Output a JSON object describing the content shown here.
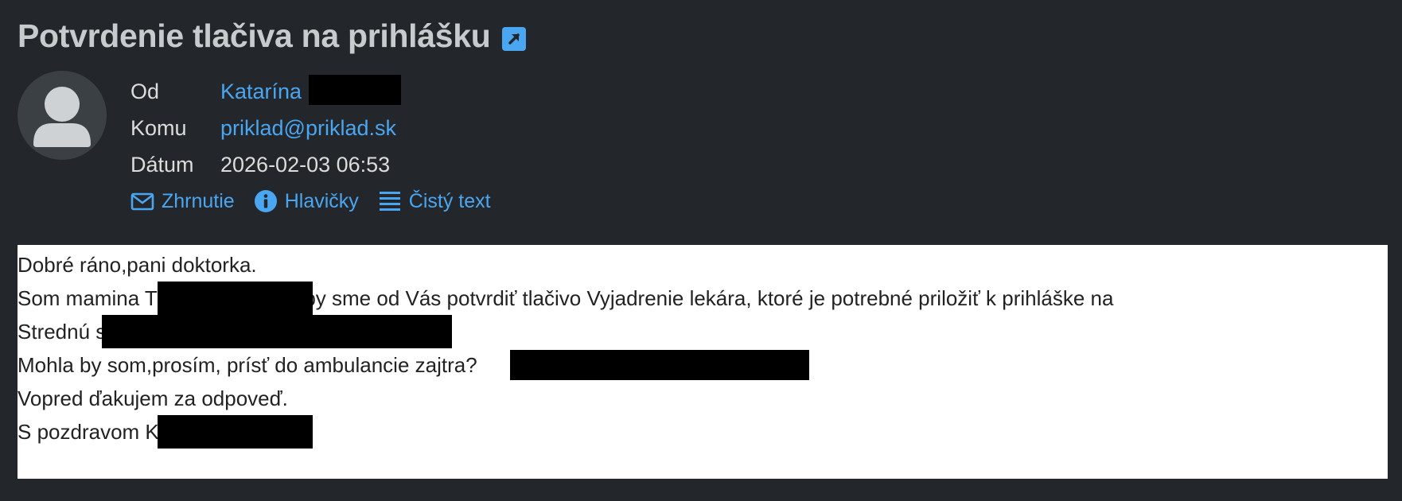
{
  "email": {
    "subject": "Potvrdenie tlačiva na prihlášku",
    "from_label": "Od",
    "from_name": "Katarína",
    "to_label": "Komu",
    "to_value": "priklad@priklad.sk",
    "date_label": "Dátum",
    "date_value": "2026-02-03 06:53"
  },
  "actions": {
    "summary": "Zhrnutie",
    "headers": "Hlavičky",
    "plain_text": "Čistý text"
  },
  "body": {
    "line1": "Dobré ráno,pani doktorka.",
    "line2": "Som mamina T                       n a  potrebovali by sme od Vás  potvrdiť tlačivo Vyjadrenie lekára, ktoré je potrebné priložiť k prihláške na",
    "line3": "Strednú s                                                                              .",
    "line4": "Mohla by som,prosím, prísť do ambulancie zajtra?",
    "line5": "Vopred ďakujem za odpoveď.",
    "line6": "S pozdravom K"
  },
  "colors": {
    "background": "#23272b",
    "link": "#4aa6f0",
    "subject": "#c8cbce",
    "body_bg": "#ffffff"
  },
  "icons": {
    "external": "external-link-icon",
    "avatar": "user-avatar-icon",
    "summary": "envelope-icon",
    "headers": "info-icon",
    "plain_text": "list-lines-icon"
  }
}
